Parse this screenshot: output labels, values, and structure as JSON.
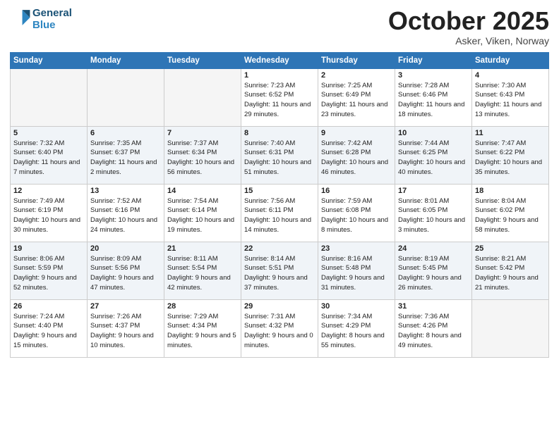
{
  "logo": {
    "line1": "General",
    "line2": "Blue"
  },
  "title": "October 2025",
  "subtitle": "Asker, Viken, Norway",
  "days_header": [
    "Sunday",
    "Monday",
    "Tuesday",
    "Wednesday",
    "Thursday",
    "Friday",
    "Saturday"
  ],
  "weeks": [
    [
      {
        "day": "",
        "sunrise": "",
        "sunset": "",
        "daylight": ""
      },
      {
        "day": "",
        "sunrise": "",
        "sunset": "",
        "daylight": ""
      },
      {
        "day": "",
        "sunrise": "",
        "sunset": "",
        "daylight": ""
      },
      {
        "day": "1",
        "sunrise": "7:23 AM",
        "sunset": "6:52 PM",
        "daylight": "11 hours and 29 minutes."
      },
      {
        "day": "2",
        "sunrise": "7:25 AM",
        "sunset": "6:49 PM",
        "daylight": "11 hours and 23 minutes."
      },
      {
        "day": "3",
        "sunrise": "7:28 AM",
        "sunset": "6:46 PM",
        "daylight": "11 hours and 18 minutes."
      },
      {
        "day": "4",
        "sunrise": "7:30 AM",
        "sunset": "6:43 PM",
        "daylight": "11 hours and 13 minutes."
      }
    ],
    [
      {
        "day": "5",
        "sunrise": "7:32 AM",
        "sunset": "6:40 PM",
        "daylight": "11 hours and 7 minutes."
      },
      {
        "day": "6",
        "sunrise": "7:35 AM",
        "sunset": "6:37 PM",
        "daylight": "11 hours and 2 minutes."
      },
      {
        "day": "7",
        "sunrise": "7:37 AM",
        "sunset": "6:34 PM",
        "daylight": "10 hours and 56 minutes."
      },
      {
        "day": "8",
        "sunrise": "7:40 AM",
        "sunset": "6:31 PM",
        "daylight": "10 hours and 51 minutes."
      },
      {
        "day": "9",
        "sunrise": "7:42 AM",
        "sunset": "6:28 PM",
        "daylight": "10 hours and 46 minutes."
      },
      {
        "day": "10",
        "sunrise": "7:44 AM",
        "sunset": "6:25 PM",
        "daylight": "10 hours and 40 minutes."
      },
      {
        "day": "11",
        "sunrise": "7:47 AM",
        "sunset": "6:22 PM",
        "daylight": "10 hours and 35 minutes."
      }
    ],
    [
      {
        "day": "12",
        "sunrise": "7:49 AM",
        "sunset": "6:19 PM",
        "daylight": "10 hours and 30 minutes."
      },
      {
        "day": "13",
        "sunrise": "7:52 AM",
        "sunset": "6:16 PM",
        "daylight": "10 hours and 24 minutes."
      },
      {
        "day": "14",
        "sunrise": "7:54 AM",
        "sunset": "6:14 PM",
        "daylight": "10 hours and 19 minutes."
      },
      {
        "day": "15",
        "sunrise": "7:56 AM",
        "sunset": "6:11 PM",
        "daylight": "10 hours and 14 minutes."
      },
      {
        "day": "16",
        "sunrise": "7:59 AM",
        "sunset": "6:08 PM",
        "daylight": "10 hours and 8 minutes."
      },
      {
        "day": "17",
        "sunrise": "8:01 AM",
        "sunset": "6:05 PM",
        "daylight": "10 hours and 3 minutes."
      },
      {
        "day": "18",
        "sunrise": "8:04 AM",
        "sunset": "6:02 PM",
        "daylight": "9 hours and 58 minutes."
      }
    ],
    [
      {
        "day": "19",
        "sunrise": "8:06 AM",
        "sunset": "5:59 PM",
        "daylight": "9 hours and 52 minutes."
      },
      {
        "day": "20",
        "sunrise": "8:09 AM",
        "sunset": "5:56 PM",
        "daylight": "9 hours and 47 minutes."
      },
      {
        "day": "21",
        "sunrise": "8:11 AM",
        "sunset": "5:54 PM",
        "daylight": "9 hours and 42 minutes."
      },
      {
        "day": "22",
        "sunrise": "8:14 AM",
        "sunset": "5:51 PM",
        "daylight": "9 hours and 37 minutes."
      },
      {
        "day": "23",
        "sunrise": "8:16 AM",
        "sunset": "5:48 PM",
        "daylight": "9 hours and 31 minutes."
      },
      {
        "day": "24",
        "sunrise": "8:19 AM",
        "sunset": "5:45 PM",
        "daylight": "9 hours and 26 minutes."
      },
      {
        "day": "25",
        "sunrise": "8:21 AM",
        "sunset": "5:42 PM",
        "daylight": "9 hours and 21 minutes."
      }
    ],
    [
      {
        "day": "26",
        "sunrise": "7:24 AM",
        "sunset": "4:40 PM",
        "daylight": "9 hours and 15 minutes."
      },
      {
        "day": "27",
        "sunrise": "7:26 AM",
        "sunset": "4:37 PM",
        "daylight": "9 hours and 10 minutes."
      },
      {
        "day": "28",
        "sunrise": "7:29 AM",
        "sunset": "4:34 PM",
        "daylight": "9 hours and 5 minutes."
      },
      {
        "day": "29",
        "sunrise": "7:31 AM",
        "sunset": "4:32 PM",
        "daylight": "9 hours and 0 minutes."
      },
      {
        "day": "30",
        "sunrise": "7:34 AM",
        "sunset": "4:29 PM",
        "daylight": "8 hours and 55 minutes."
      },
      {
        "day": "31",
        "sunrise": "7:36 AM",
        "sunset": "4:26 PM",
        "daylight": "8 hours and 49 minutes."
      },
      {
        "day": "",
        "sunrise": "",
        "sunset": "",
        "daylight": ""
      }
    ]
  ]
}
